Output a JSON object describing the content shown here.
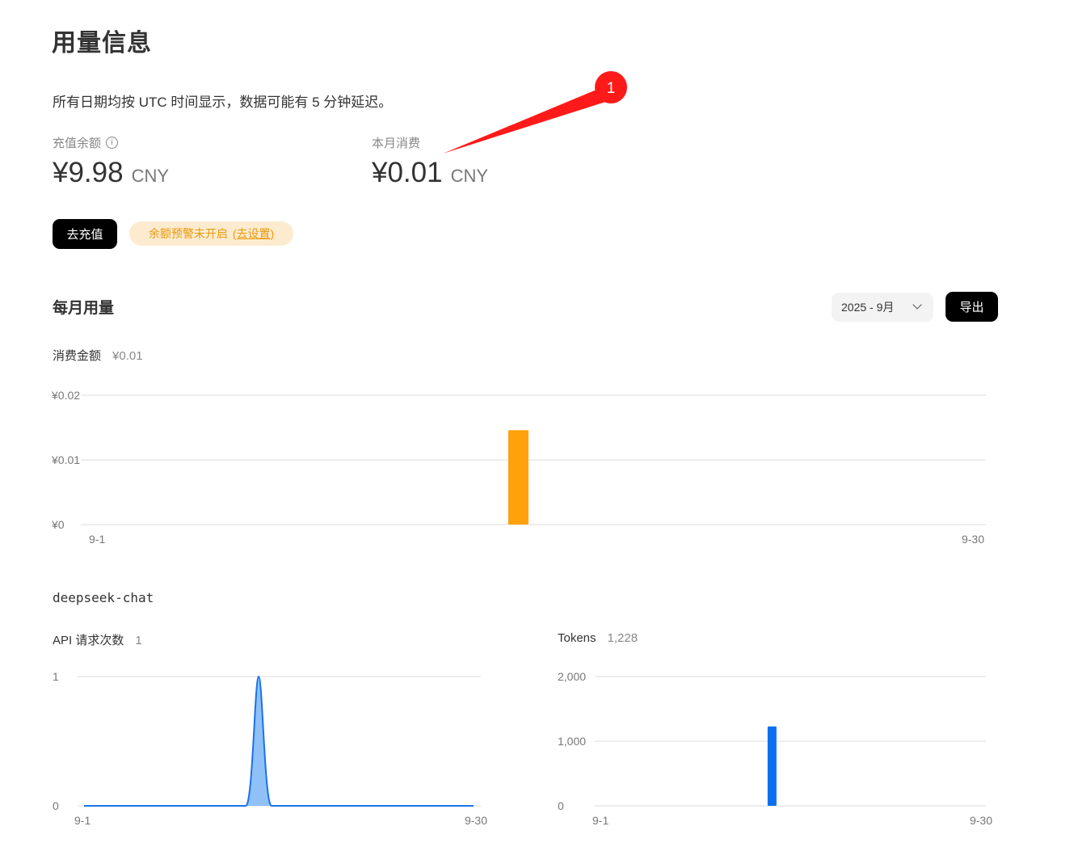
{
  "page": {
    "title": "用量信息",
    "notice": "所有日期均按 UTC 时间显示，数据可能有 5 分钟延迟。"
  },
  "balance": {
    "label": "充值余额",
    "value": "¥9.98",
    "currency": "CNY",
    "info_icon": "info-circle-icon"
  },
  "monthly_spend": {
    "label": "本月消费",
    "value": "¥0.01",
    "currency": "CNY"
  },
  "annotation": {
    "number": "1",
    "color": "#ff1a1a"
  },
  "actions": {
    "topup_label": "去充值"
  },
  "balance_alert": {
    "text": "余额预警未开启",
    "link": "(去设置)",
    "color": "#e89a0c"
  },
  "monthly_usage": {
    "title": "每月用量",
    "selected_month": "2025 - 9月",
    "export_label": "导出",
    "cost_label": "消费金额",
    "cost_total": "¥0.01"
  },
  "model": {
    "name": "deepseek-chat",
    "requests_label": "API 请求次数",
    "requests_total": "1",
    "tokens_label": "Tokens",
    "tokens_total": "1,228"
  },
  "chart_data": [
    {
      "type": "bar",
      "y_tick_labels": [
        "¥0",
        "¥0.01",
        "¥0.02"
      ],
      "ylim": [
        0,
        0.02
      ],
      "x_tick_labels": [
        "9-1",
        "9-30"
      ],
      "xlim": [
        1,
        30
      ],
      "bars": [
        {
          "x": 15,
          "value": 0.0146
        }
      ],
      "color": "#ffa10a",
      "grid": true
    },
    {
      "type": "area",
      "y_tick_labels": [
        "0",
        "1"
      ],
      "ylim": [
        0,
        1
      ],
      "x_tick_labels": [
        "9-1",
        "9-30"
      ],
      "xlim": [
        1,
        30
      ],
      "points": [
        {
          "x": 14,
          "value": 1
        }
      ],
      "color": "#1a73e8",
      "grid": true
    },
    {
      "type": "bar",
      "y_tick_labels": [
        "0",
        "1,000",
        "2,000"
      ],
      "ylim": [
        0,
        2000
      ],
      "x_tick_labels": [
        "9-1",
        "9-30"
      ],
      "xlim": [
        1,
        30
      ],
      "bars": [
        {
          "x": 14,
          "value": 1228
        }
      ],
      "color": "#0b6ff0",
      "grid": true
    }
  ]
}
